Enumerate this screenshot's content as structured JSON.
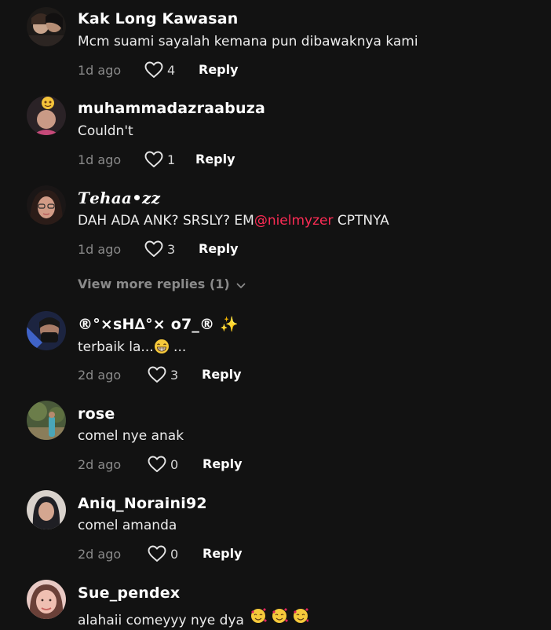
{
  "comments": [
    {
      "username": "Kak Long Kawasan",
      "text": "Mcm suami sayalah kemana pun dibawaknya kami",
      "time": "1d ago",
      "likes": "4",
      "reply_label": "Reply"
    },
    {
      "username": "muhammadazraabuza",
      "text": "Couldn't",
      "time": "1d ago",
      "likes": "1",
      "reply_label": "Reply"
    },
    {
      "username": "𝑻𝒆𝒉𝒂𝒂•𝒛𝒛",
      "text_before": "DAH ADA ANK? SRSLY? EM",
      "mention": "@nielmyzer",
      "text_after": " CPTNYA",
      "time": "1d ago",
      "likes": "3",
      "reply_label": "Reply"
    },
    {
      "username": "®°×sH∆°× o7_® ✨",
      "text_before": "terbaik la...",
      "text_after": " ...",
      "time": "2d ago",
      "likes": "3",
      "reply_label": "Reply"
    },
    {
      "username": "rose",
      "text": "comel nye anak",
      "time": "2d ago",
      "likes": "0",
      "reply_label": "Reply"
    },
    {
      "username": "Aniq_Noraini92",
      "text": "comel amanda",
      "time": "2d ago",
      "likes": "0",
      "reply_label": "Reply"
    },
    {
      "username": "Sue_pendex",
      "text": "alahaii comeyyy nye dya"
    }
  ],
  "view_more_replies": "View more replies (1)",
  "colors": {
    "background": "#121212",
    "mention": "#fe2c55",
    "muted": "#8a8a8a"
  }
}
